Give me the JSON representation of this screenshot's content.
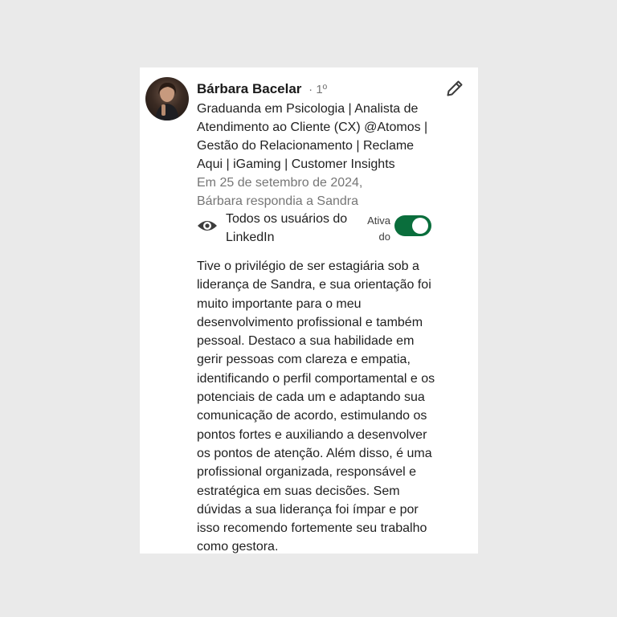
{
  "recommendation": {
    "name": "Bárbara Bacelar",
    "degree": "· 1º",
    "headline": "Graduanda em Psicologia | Analista de Atendimento ao Cliente (CX) @Atomos | Gestão do Relacionamento | Reclame Aqui | iGaming | Customer Insights",
    "date_line": "Em 25 de setembro de 2024, Bárbara respondia a Sandra",
    "visibility": {
      "icon": "eye-icon",
      "label": "Todos os usuários do LinkedIn"
    },
    "toggle": {
      "label": "Ativado",
      "label_line1": "Ativa",
      "label_line2": "do",
      "on": true,
      "color": "#0a6e3c"
    },
    "edit_icon": "pencil-icon",
    "text": "Tive o privilégio de ser estagiária sob a liderança de Sandra, e sua orientação foi muito importante para o meu desenvolvimento profissional e também pessoal. Destaco a sua habilidade em gerir pessoas com clareza e empatia, identificando o perfil comportamental e os potenciais de cada um e adaptando sua comunicação de acordo, estimulando os pontos fortes e auxiliando a desenvolver os pontos de atenção. Além disso, é uma profissional organizada, responsável e estratégica em suas decisões. Sem dúvidas a sua liderança foi ímpar e por isso recomendo fortemente seu trabalho como gestora."
  }
}
